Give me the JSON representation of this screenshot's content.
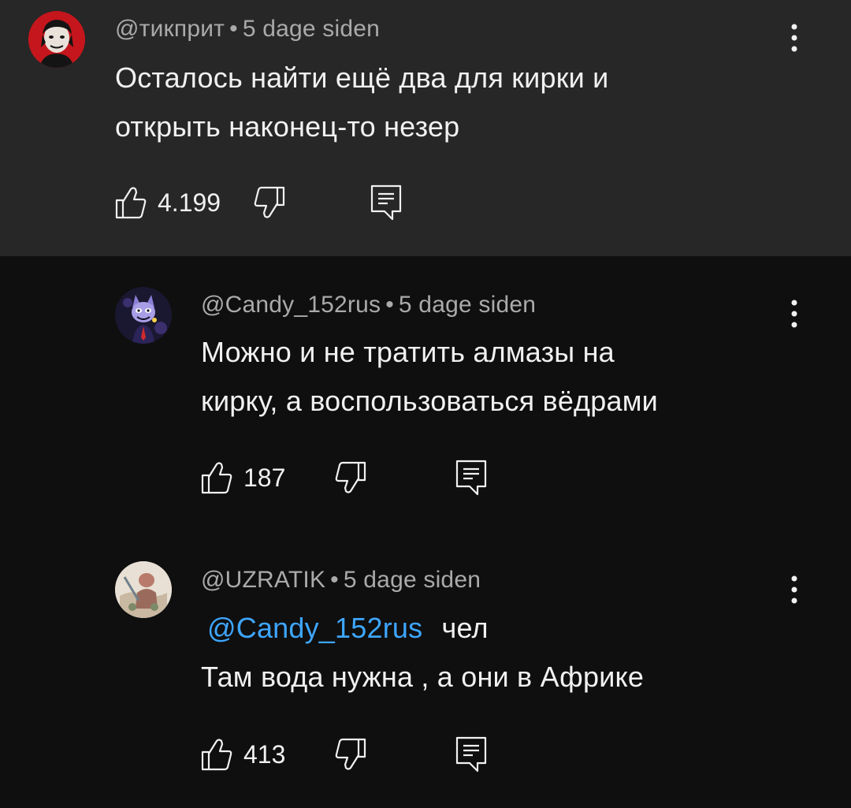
{
  "comments": [
    {
      "author": "@тикприт",
      "time": "5 dage siden",
      "lines": [
        "Осталось найти ещё два для кирки и",
        "открыть наконец-то незер"
      ],
      "likes": "4.199"
    },
    {
      "author": "@Candy_152rus",
      "time": "5 dage siden",
      "lines": [
        "Можно и не тратить алмазы на",
        "кирку, а воспользоваться вёдрами"
      ],
      "likes": "187"
    },
    {
      "author": "@UZRATIK",
      "time": "5 dage siden",
      "mention": "@Candy_152rus",
      "mention_rest": "чел",
      "lines": [
        "Там вода нужна , а они в Африке"
      ],
      "likes": "413"
    }
  ],
  "separator": "•",
  "colors": {
    "background": "#0f0f0f",
    "highlight": "#272727",
    "text": "#f1f1f1",
    "meta": "#aaaaaa",
    "mention": "#3ea6ff"
  },
  "icons": [
    "like-icon",
    "dislike-icon",
    "reply-icon",
    "more-options-icon"
  ]
}
